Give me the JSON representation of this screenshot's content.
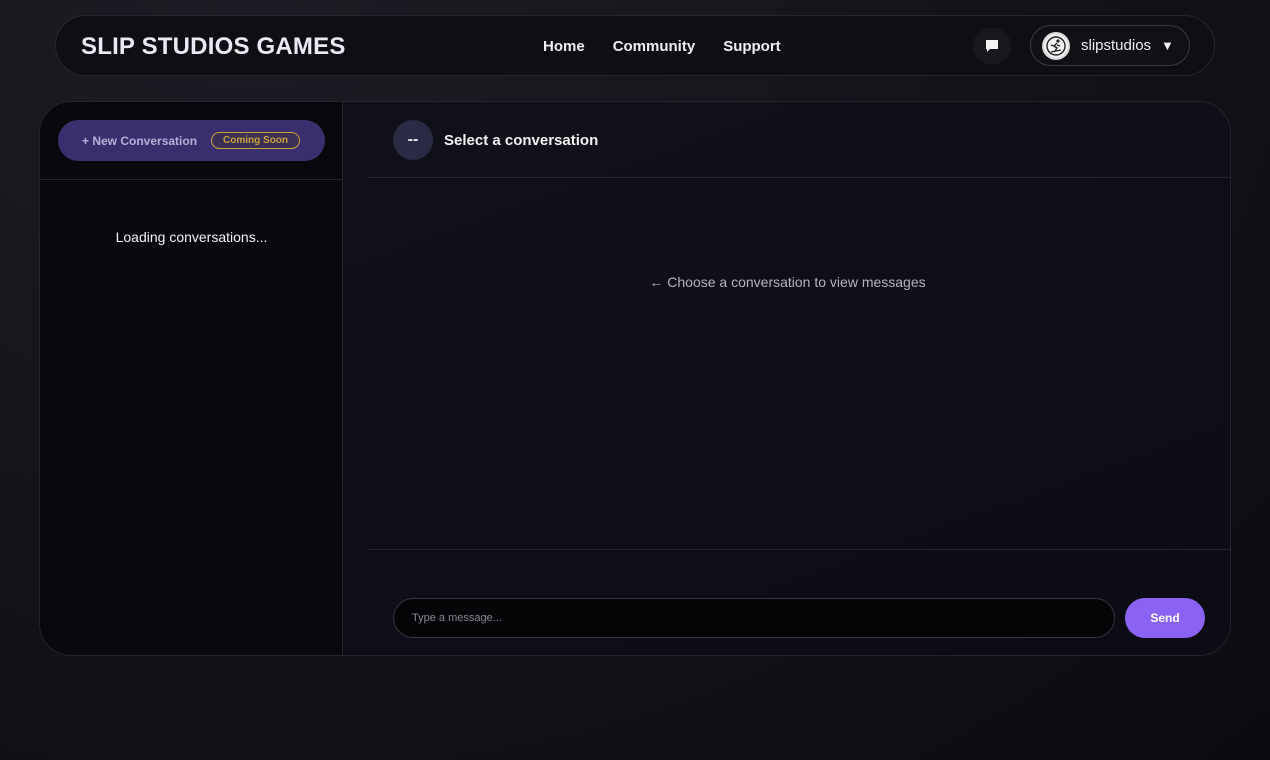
{
  "navbar": {
    "brand": "SLIP STUDIOS GAMES",
    "links": [
      "Home",
      "Community",
      "Support"
    ],
    "messages_icon": "chat-bubble-icon",
    "user": {
      "name": "slipstudios",
      "avatar_icon": "skater-logo-icon",
      "caret": "▼"
    }
  },
  "sidebar": {
    "new_conversation_label": "+ New Conversation",
    "coming_soon_badge": "Coming Soon",
    "loading_text": "Loading conversations..."
  },
  "chat": {
    "avatar_text": "--",
    "title": "Select a conversation",
    "empty_message": "← Choose a conversation to view messages",
    "input_placeholder": "Type a message...",
    "send_label": "Send"
  },
  "colors": {
    "accent": "#8a63f5",
    "new_conversation_bg": "#3a2f6e",
    "badge": "#c9a13a"
  }
}
